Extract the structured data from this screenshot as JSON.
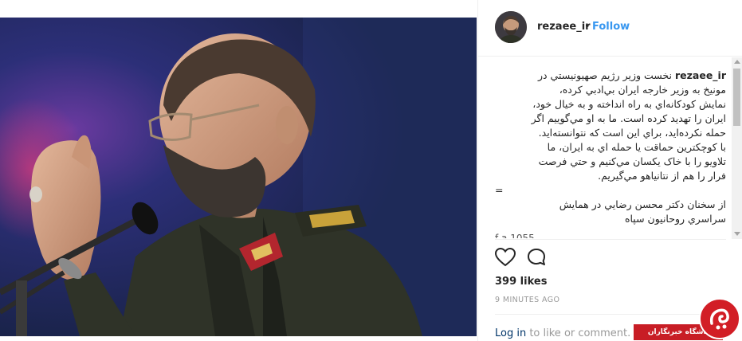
{
  "header": {
    "username": "rezaee_ir",
    "separator": "•",
    "follow_label": "Follow"
  },
  "caption": {
    "username": "rezaee_ir",
    "lines": [
      "نخست وزير رژيم صهيونيستي در",
      "مونيخ به وزير خارجه ايران بي‌ادبي كرده،",
      "نمايش كودكانه‌اي به راه انداخته و به خيال خود،",
      "ايران را تهديد كرده است. ما به او مي‌گوييم اگر",
      "حمله نكرده‌ايد، براي اين است كه نتوانسته‌ايد.",
      "با كوچكترين حماقت يا حمله اي به ايران، ما",
      "تلاويو را با خاک يكسان مي‌كنيم و حتي فرصت",
      "فرار را هم از نتانياهو مي‌گيريم.",
      "=",
      "از سخنان دكتر محسن رضايي در همايش",
      "سراسري روحانيون سپاه"
    ],
    "cut_line": "f a 1055 ...",
    "scroll_fraction": 0.3
  },
  "actions": {
    "like_icon": "heart-icon",
    "comment_icon": "comment-icon"
  },
  "likes_text": "399 likes",
  "timestamp": "9 MINUTES AGO",
  "footer": {
    "login_link": "Log in",
    "login_rest": " to like or comment."
  },
  "watermark": {
    "text": "باشگاه خبرنگاران",
    "color": "#c81d25"
  }
}
